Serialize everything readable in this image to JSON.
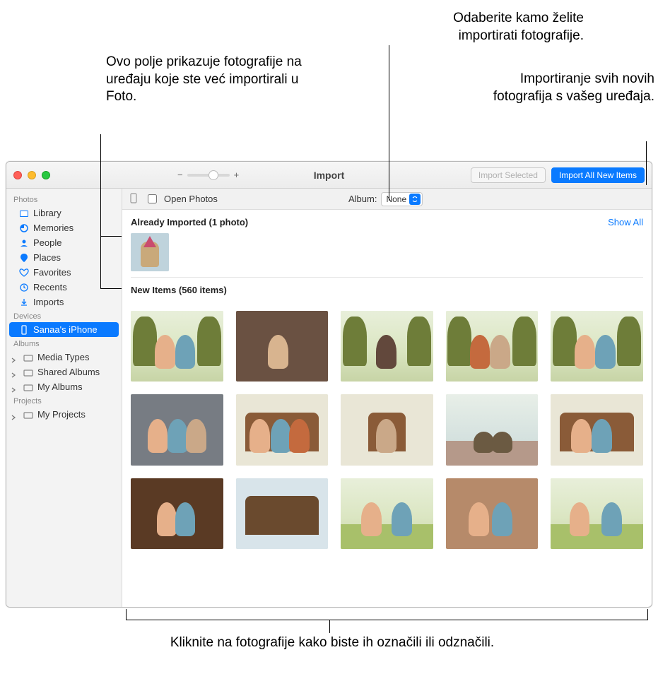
{
  "callouts": {
    "already": "Ovo polje prikazuje fotografije na uređaju koje ste već importirali u Foto.",
    "destination": "Odaberite kamo želite importirati fotografije.",
    "importall": "Importiranje svih novih fotografija s vašeg uređaja.",
    "clickphotos": "Kliknite na fotografije kako biste ih označili ili odznačili."
  },
  "toolbar": {
    "title": "Import",
    "import_selected": "Import Selected",
    "import_all": "Import All New Items"
  },
  "subbar": {
    "open_photos": "Open Photos",
    "album_label": "Album:",
    "album_value": "None"
  },
  "sections": {
    "already": "Already Imported (1 photo)",
    "showall": "Show All",
    "newitems": "New Items (560 items)"
  },
  "sidebar": {
    "h_photos": "Photos",
    "library": "Library",
    "memories": "Memories",
    "people": "People",
    "places": "Places",
    "favorites": "Favorites",
    "recents": "Recents",
    "imports": "Imports",
    "h_devices": "Devices",
    "device": "Sanaa's iPhone",
    "h_albums": "Albums",
    "mediatypes": "Media Types",
    "shared": "Shared Albums",
    "myalbums": "My Albums",
    "h_projects": "Projects",
    "myprojects": "My Projects"
  }
}
